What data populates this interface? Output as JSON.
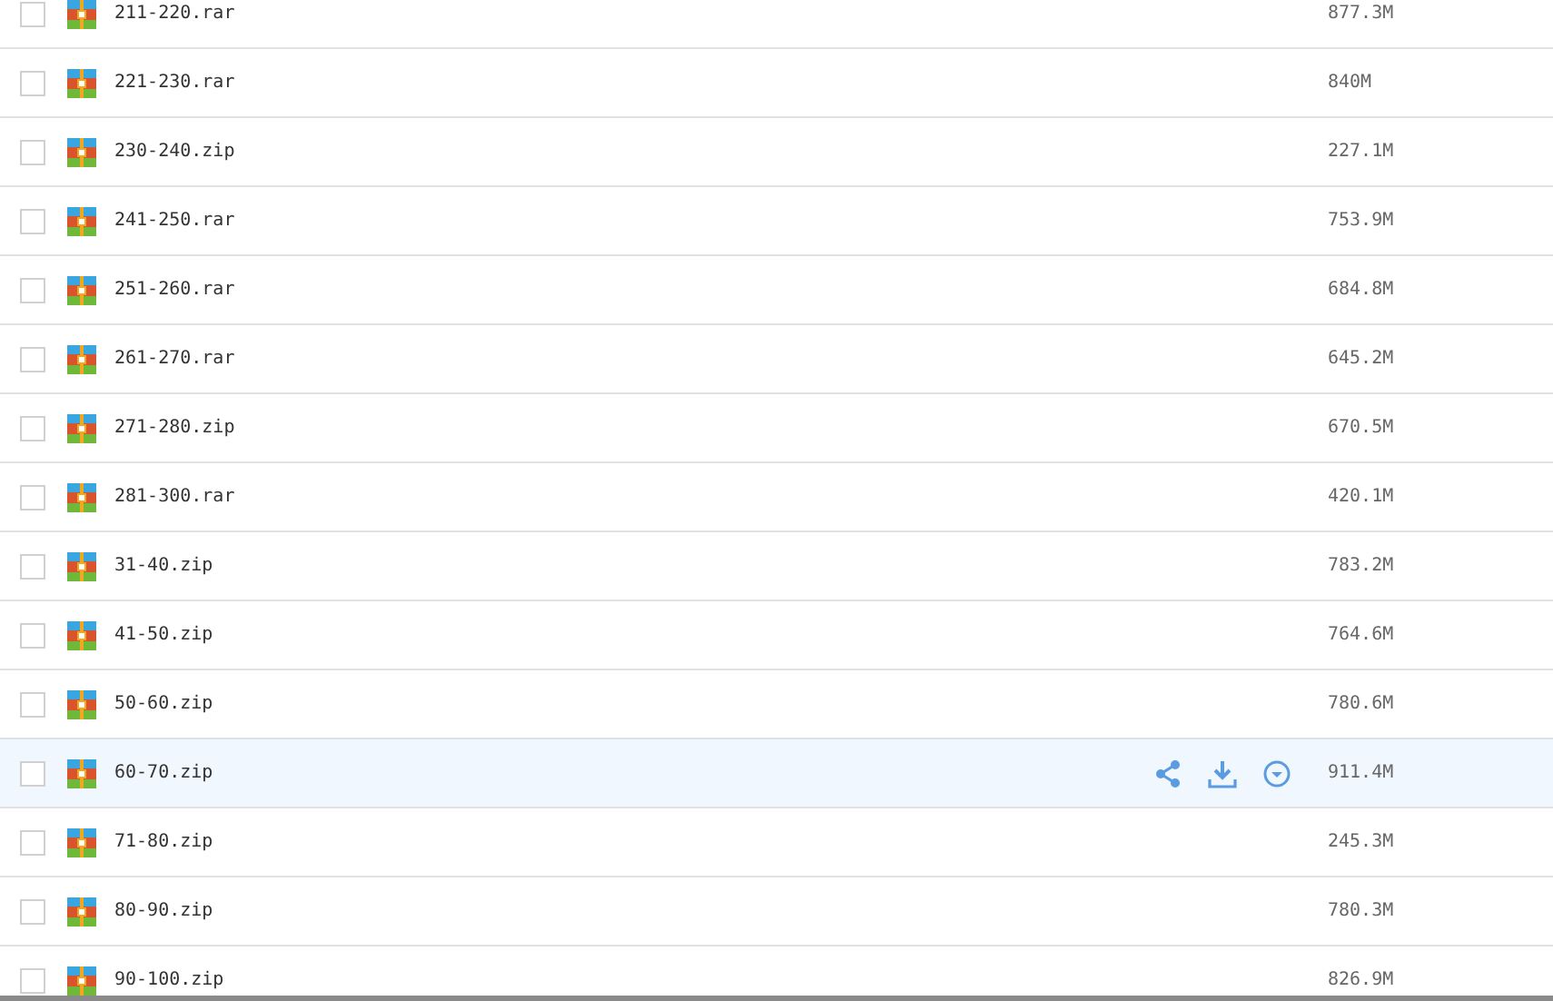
{
  "files": [
    {
      "name": "211-220.rar",
      "size": "877.3M",
      "checked": false,
      "hovered": false
    },
    {
      "name": "221-230.rar",
      "size": "840M",
      "checked": false,
      "hovered": false
    },
    {
      "name": "230-240.zip",
      "size": "227.1M",
      "checked": false,
      "hovered": false
    },
    {
      "name": "241-250.rar",
      "size": "753.9M",
      "checked": false,
      "hovered": false
    },
    {
      "name": "251-260.rar",
      "size": "684.8M",
      "checked": false,
      "hovered": false
    },
    {
      "name": "261-270.rar",
      "size": "645.2M",
      "checked": false,
      "hovered": false
    },
    {
      "name": "271-280.zip",
      "size": "670.5M",
      "checked": false,
      "hovered": false
    },
    {
      "name": "281-300.rar",
      "size": "420.1M",
      "checked": false,
      "hovered": false
    },
    {
      "name": "31-40.zip",
      "size": "783.2M",
      "checked": false,
      "hovered": false
    },
    {
      "name": "41-50.zip",
      "size": "764.6M",
      "checked": false,
      "hovered": false
    },
    {
      "name": "50-60.zip",
      "size": "780.6M",
      "checked": false,
      "hovered": false
    },
    {
      "name": "60-70.zip",
      "size": "911.4M",
      "checked": false,
      "hovered": true
    },
    {
      "name": "71-80.zip",
      "size": "245.3M",
      "checked": false,
      "hovered": false
    },
    {
      "name": "80-90.zip",
      "size": "780.3M",
      "checked": false,
      "hovered": false
    },
    {
      "name": "90-100.zip",
      "size": "826.9M",
      "checked": false,
      "hovered": false
    }
  ]
}
